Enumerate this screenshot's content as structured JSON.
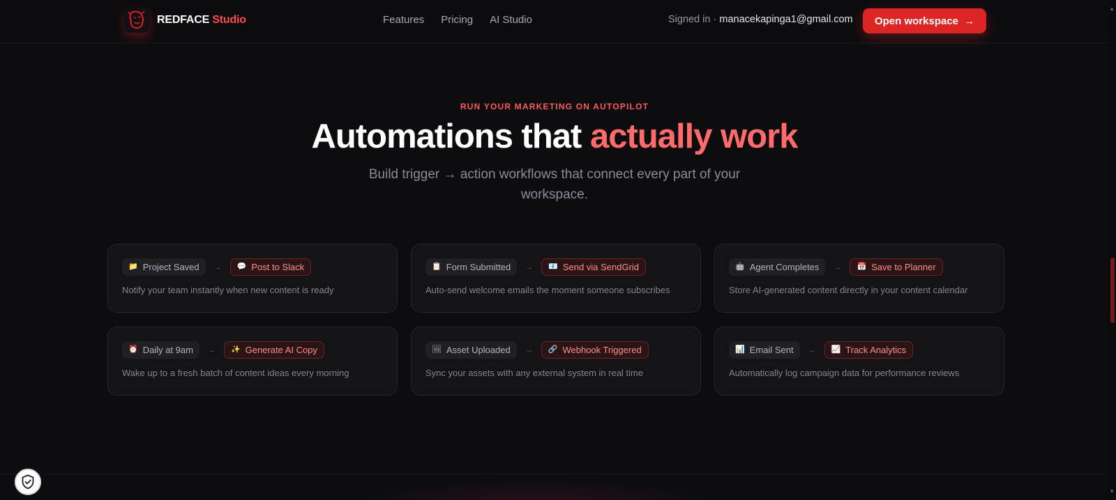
{
  "nav": {
    "brand_main": "REDFACE",
    "brand_accent": "Studio",
    "links": [
      {
        "label": "Features"
      },
      {
        "label": "Pricing"
      },
      {
        "label": "AI Studio"
      }
    ],
    "signed_prefix": "Signed in ·",
    "email": "manacekapinga1@gmail.com",
    "cta_label": "Open workspace",
    "cta_arrow": "→"
  },
  "hero": {
    "eyebrow": "RUN YOUR MARKETING ON AUTOPILOT",
    "title_main": "Automations that",
    "title_accent": "actually work",
    "subtitle": "Build trigger → action workflows that connect every part of your workspace."
  },
  "cards": [
    {
      "trigger_icon": "📁",
      "trigger": "Project Saved",
      "action_icon": "💬",
      "action": "Post to Slack",
      "desc": "Notify your team instantly when new content is ready"
    },
    {
      "trigger_icon": "📋",
      "trigger": "Form Submitted",
      "action_icon": "📧",
      "action": "Send via SendGrid",
      "desc": "Auto-send welcome emails the moment someone subscribes"
    },
    {
      "trigger_icon": "🤖",
      "trigger": "Agent Completes",
      "action_icon": "📅",
      "action": "Save to Planner",
      "desc": "Store AI-generated content directly in your content calendar"
    },
    {
      "trigger_icon": "⏰",
      "trigger": "Daily at 9am",
      "action_icon": "✨",
      "action": "Generate AI Copy",
      "desc": "Wake up to a fresh batch of content ideas every morning"
    },
    {
      "trigger_icon": "🖼",
      "trigger": "Asset Uploaded",
      "action_icon": "🔗",
      "action": "Webhook Triggered",
      "desc": "Sync your assets with any external system in real time"
    },
    {
      "trigger_icon": "📊",
      "trigger": "Email Sent",
      "action_icon": "📈",
      "action": "Track Analytics",
      "desc": "Automatically log campaign data for performance reviews"
    }
  ],
  "separator": "→",
  "colors": {
    "accent": "#dc2626",
    "accent_text": "#ff6b6b",
    "background": "#0d0d10"
  },
  "icons": {
    "logo": "redface-logo-icon",
    "shield": "shield-check-icon"
  }
}
